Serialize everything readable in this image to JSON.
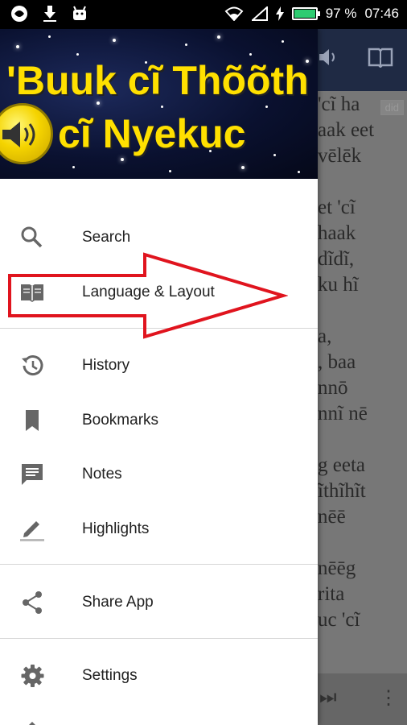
{
  "status_bar": {
    "battery": "97 %",
    "time": "07:46",
    "accent": "#2ecc71"
  },
  "header": {
    "title_line1": "'Buuk cĩ Thõõth",
    "title_line2": "cĩ Nyekuc",
    "title_color": "#ffe000"
  },
  "menu": {
    "search": "Search",
    "language_layout": "Language & Layout",
    "history": "History",
    "bookmarks": "Bookmarks",
    "notes": "Notes",
    "highlights": "Highlights",
    "share_app": "Share App",
    "settings": "Settings"
  },
  "reader": {
    "did_label": "did",
    "lines": [
      "'cĩ ha",
      "aak eet",
      "vēlēk",
      "",
      "et 'cĩ",
      "haak",
      "dĩdĩ,",
      "ku hĩ",
      "",
      "a,",
      ", baa",
      "nnō",
      "nnĩ nē",
      "",
      "g eeta",
      "ĩthĩhĩt",
      "nēē",
      "",
      "nēēg",
      "rita",
      "uc 'cĩ"
    ]
  },
  "annotation": {
    "arrow_color": "#e0141e"
  }
}
